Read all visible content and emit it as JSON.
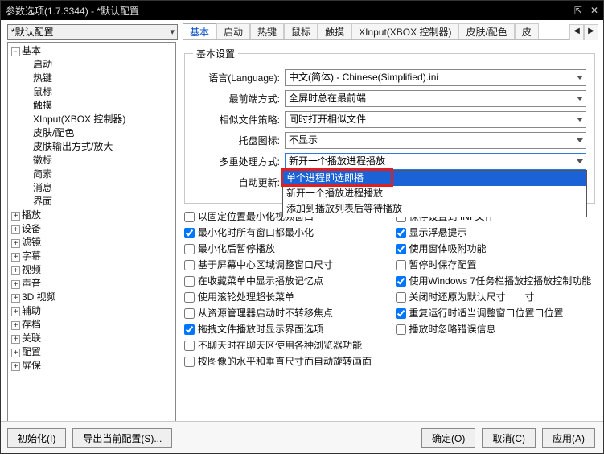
{
  "title": "参数选项(1.7.3344) - *默认配置",
  "profile": "*默认配置",
  "tabs": [
    "基本",
    "启动",
    "热键",
    "鼠标",
    "触摸",
    "XInput(XBOX 控制器)",
    "皮肤/配色",
    "皮"
  ],
  "tab_arrows": {
    "left": "◀",
    "right": "▶"
  },
  "tree": {
    "basic": "基本",
    "basic_children": [
      "启动",
      "热键",
      "鼠标",
      "触摸",
      "XInput(XBOX 控制器)",
      "皮肤/配色",
      "皮肤输出方式/放大",
      "徽标",
      "简素",
      "消息",
      "界面"
    ],
    "others": [
      "播放",
      "设备",
      "滤镜",
      "字幕",
      "视频",
      "声音",
      "3D 视频",
      "辅助",
      "存档",
      "关联",
      "配置",
      "屏保"
    ]
  },
  "fieldset_title": "基本设置",
  "form": {
    "language_label": "语言(Language):",
    "language_value": "中文(简体) - Chinese(Simplified).ini",
    "topmost_label": "最前端方式:",
    "topmost_value": "全屏时总在最前端",
    "similar_label": "相似文件策略:",
    "similar_value": "同时打开相似文件",
    "tray_label": "托盘图标:",
    "tray_value": "不显示",
    "multi_label": "多重处理方式:",
    "multi_value": "新开一个播放进程播放",
    "update_label": "自动更新:"
  },
  "dropdown_options": [
    "单个进程即选即播",
    "新开一个播放进程播放",
    "添加到播放列表后等待播放"
  ],
  "checkboxes_left": [
    {
      "label": "以固定位置最小化视频窗口",
      "checked": false
    },
    {
      "label": "最小化时所有窗口都最小化",
      "checked": true
    },
    {
      "label": "最小化后暂停播放",
      "checked": false
    },
    {
      "label": "基于屏幕中心区域调整窗口尺寸",
      "checked": false
    },
    {
      "label": "在收藏菜单中显示播放记忆点",
      "checked": false
    },
    {
      "label": "使用滚轮处理超长菜单",
      "checked": false
    },
    {
      "label": "从资源管理器启动时不转移焦点",
      "checked": false
    },
    {
      "label": "拖拽文件播放时显示界面选项",
      "checked": true
    },
    {
      "label": "不聊天时在聊天区使用各种浏览器功能",
      "checked": false
    },
    {
      "label": "按图像的水平和垂直尺寸而自动旋转画面",
      "checked": false
    }
  ],
  "checkboxes_right": [
    {
      "label": "保存设置到 INI 文件",
      "checked": false
    },
    {
      "label": "显示浮悬提示",
      "checked": true
    },
    {
      "label": "使用窗体吸附功能",
      "checked": true
    },
    {
      "label": "暂停时保存配置",
      "checked": false
    },
    {
      "label": "使用Windows 7任务栏播放控播放控制功能",
      "checked": true
    },
    {
      "label": "关闭时还原为默认尺寸　　寸",
      "checked": false
    },
    {
      "label": "重复运行时适当调整窗口位置口位置",
      "checked": true
    },
    {
      "label": "播放时忽略错误信息",
      "checked": false
    }
  ],
  "buttons": {
    "init": "初始化(I)",
    "export": "导出当前配置(S)...",
    "ok": "确定(O)",
    "cancel": "取消(C)",
    "apply": "应用(A)"
  },
  "winbtns": {
    "pin": "⇱",
    "close": "✕"
  }
}
